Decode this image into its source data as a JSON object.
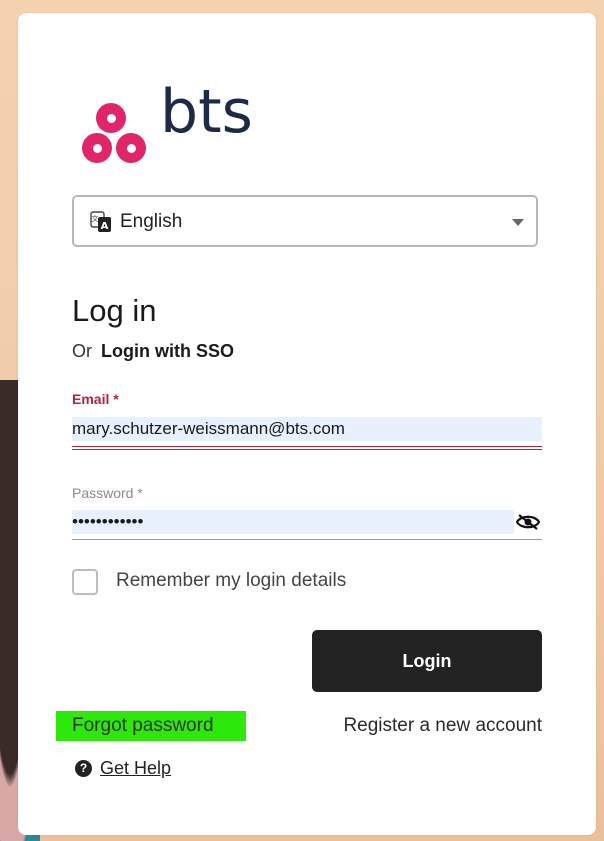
{
  "brand": {
    "name": "bts",
    "accent": "#e0256a",
    "text_color": "#1e2a45"
  },
  "language": {
    "selected": "English",
    "icon": "translate-icon"
  },
  "login": {
    "heading": "Log in",
    "or_text": "Or",
    "sso_label": "Login with SSO",
    "email_label": "Email *",
    "email_value": "mary.schutzer-weissmann@bts.com",
    "password_label": "Password *",
    "password_value": "••••••••••••",
    "remember_label": "Remember my login details",
    "remember_checked": false,
    "login_button": "Login",
    "forgot_password": "Forgot password",
    "register": "Register a new account",
    "get_help": "Get Help"
  },
  "colors": {
    "highlight": "#2ee80b",
    "button_bg": "#222222",
    "error_label": "#b0243e",
    "input_bg": "#e8f0fe"
  }
}
